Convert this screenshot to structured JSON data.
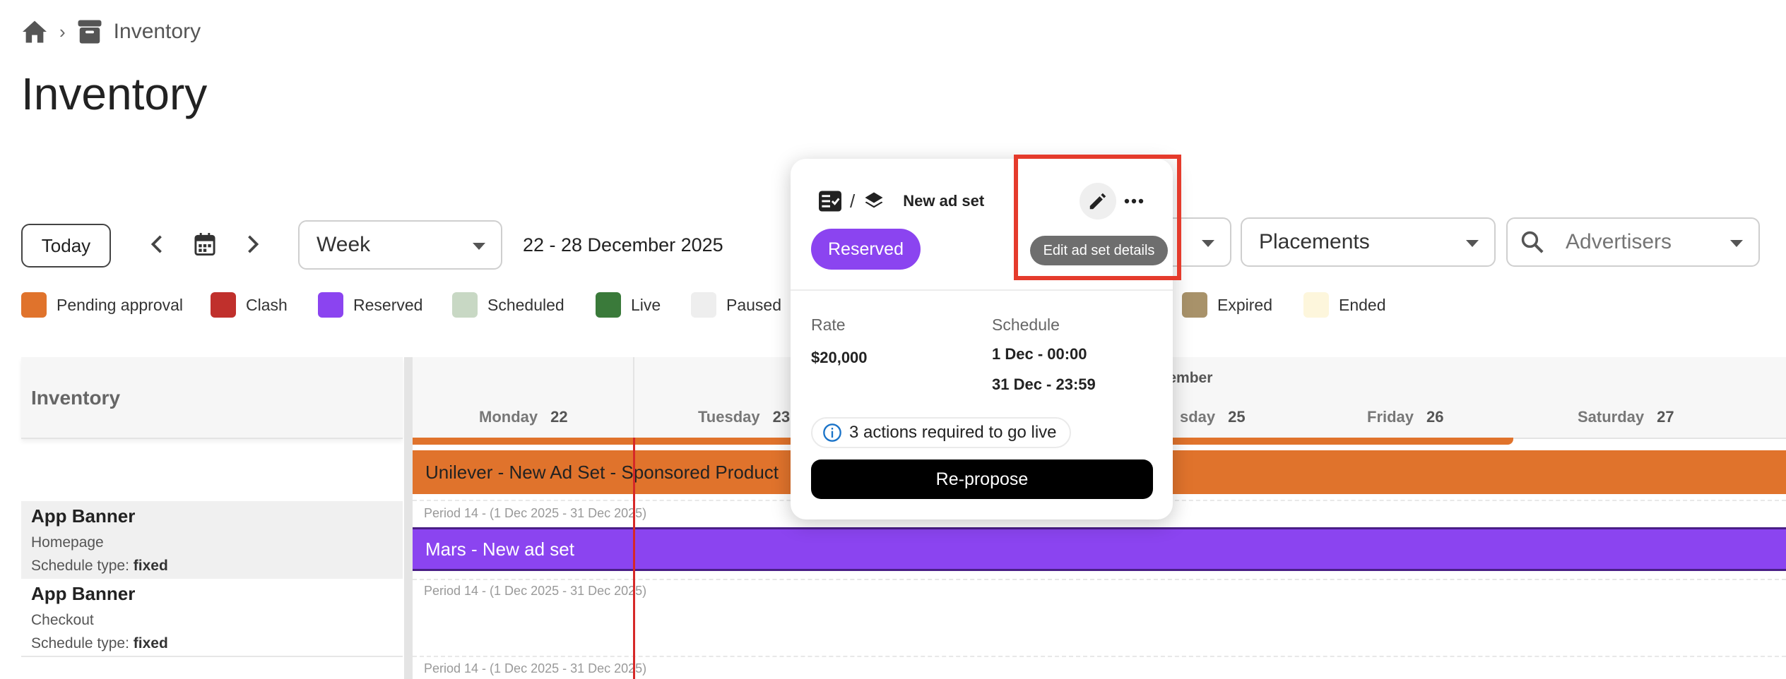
{
  "breadcrumb": {
    "home_icon": "home-icon",
    "separator": "›",
    "section_icon": "archive-icon",
    "current": "Inventory"
  },
  "page": {
    "title": "Inventory"
  },
  "toolbar": {
    "today_label": "Today",
    "view_select": "Week",
    "date_range": "22 - 28 December 2025",
    "placements_select": "Placements",
    "advertisers_placeholder": "Advertisers"
  },
  "legend": [
    {
      "label": "Pending approval",
      "color": "#e0732c"
    },
    {
      "label": "Clash",
      "color": "#c0302c"
    },
    {
      "label": "Reserved",
      "color": "#8b44f0"
    },
    {
      "label": "Scheduled",
      "color": "#c8d8c4"
    },
    {
      "label": "Live",
      "color": "#3a7a3a"
    },
    {
      "label": "Paused",
      "color": "#eeeeee"
    },
    {
      "label": "Expired",
      "color": "#a8926a"
    },
    {
      "label": "Ended",
      "color": "#fdf6dc"
    }
  ],
  "grid": {
    "side_header": "Inventory",
    "month_label": "ecember",
    "days": [
      {
        "name": "Monday",
        "num": "22"
      },
      {
        "name": "Tuesday",
        "num": "23"
      },
      {
        "name": "sday",
        "num": "25"
      },
      {
        "name": "Friday",
        "num": "26"
      },
      {
        "name": "Saturday",
        "num": "27"
      }
    ],
    "rows": [
      {
        "title": "App Banner",
        "subtitle": "Homepage",
        "type_label": "Schedule type: ",
        "type_value": "fixed",
        "period": "Period 14 - (1 Dec 2025 - 31 Dec 2025)"
      },
      {
        "title": "App Banner",
        "subtitle": "Checkout",
        "type_label": "Schedule type: ",
        "type_value": "fixed",
        "period": "Period 14 - (1 Dec 2025 - 31 Dec 2025)"
      },
      {
        "period": "Period 14 - (1 Dec 2025 - 31 Dec 2025)"
      }
    ],
    "bars": [
      {
        "label": "Unilever - New Ad Set - Sponsored Product",
        "color": "#e0732c"
      },
      {
        "label": "Mars - New ad set",
        "color": "#8b44f0"
      }
    ]
  },
  "popover": {
    "type_icon": "list-check-icon",
    "layers_icon": "layers-icon",
    "separator": "/",
    "title": "New ad set",
    "status": "Reserved",
    "rate_label": "Rate",
    "rate_value": "$20,000",
    "schedule_label": "Schedule",
    "schedule_start": "1 Dec - 00:00",
    "schedule_end": "31 Dec - 23:59",
    "info_text": "3 actions required to go live",
    "cta_label": "Re-propose",
    "tooltip": "Edit ad set details"
  }
}
